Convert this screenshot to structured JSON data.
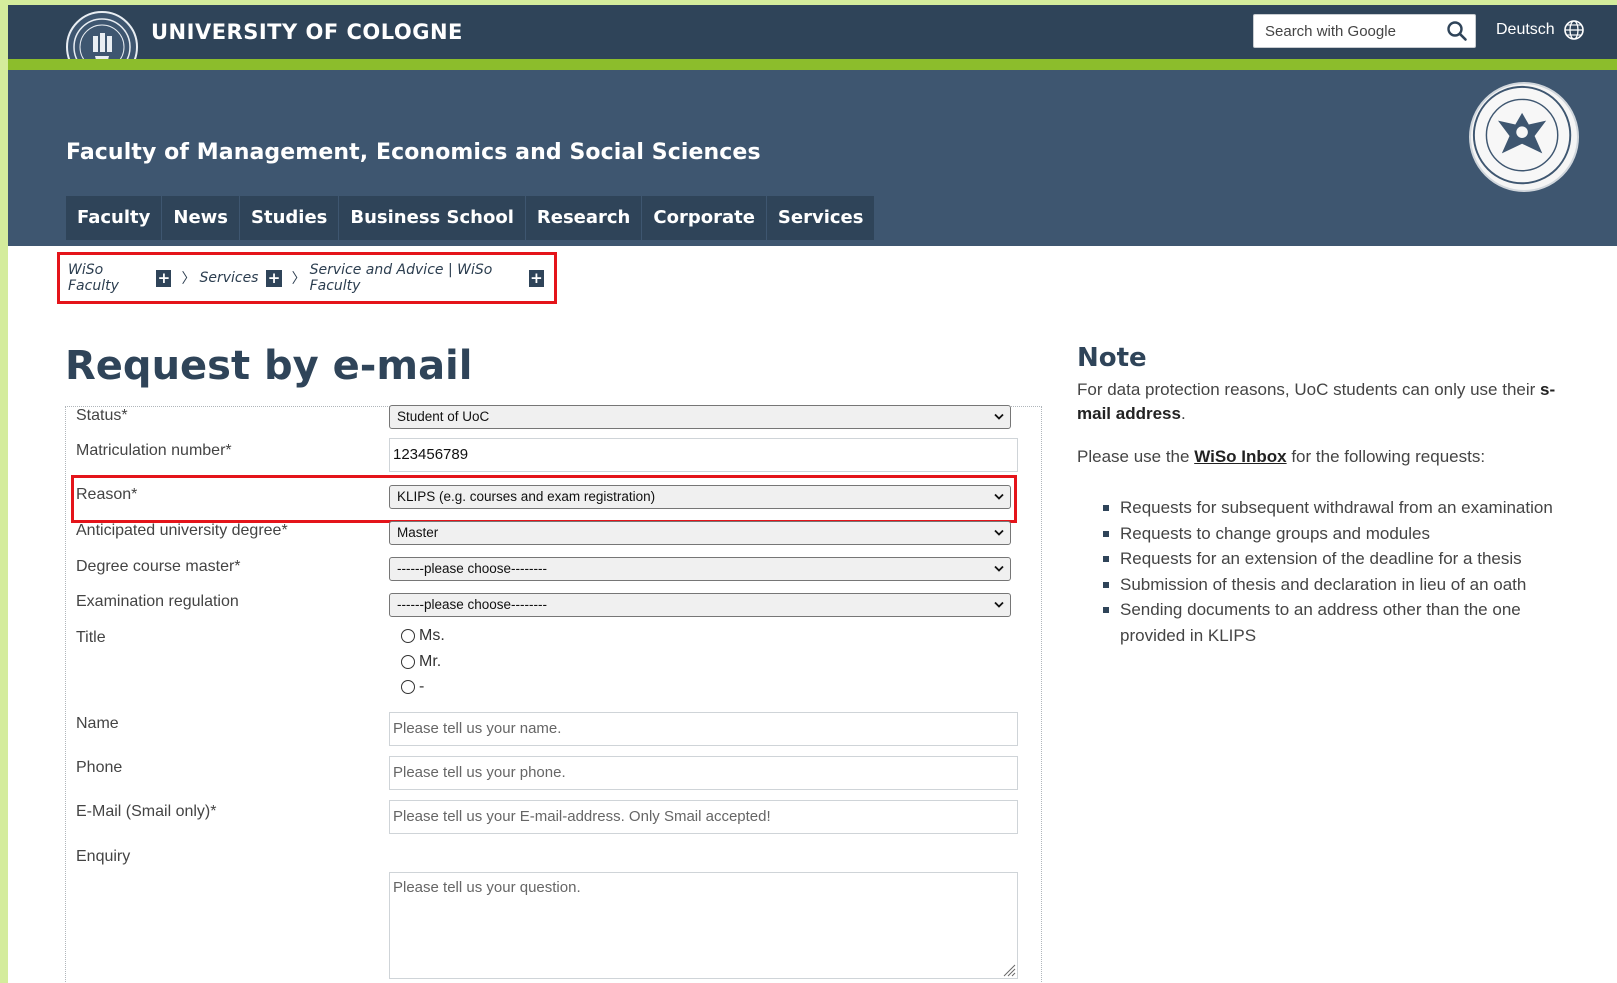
{
  "header": {
    "university_name": "UNIVERSITY OF COLOGNE",
    "search_placeholder": "Search with Google",
    "language_link": "Deutsch",
    "faculty_title": "Faculty of Management, Economics and Social Sciences"
  },
  "nav": {
    "items": [
      {
        "label": "Faculty"
      },
      {
        "label": "News"
      },
      {
        "label": "Studies"
      },
      {
        "label": "Business School"
      },
      {
        "label": "Research"
      },
      {
        "label": "Corporate"
      },
      {
        "label": "Services"
      }
    ]
  },
  "breadcrumb": {
    "items": [
      {
        "label": "WiSo Faculty"
      },
      {
        "label": "Services"
      },
      {
        "label": "Service and Advice | WiSo Faculty"
      }
    ],
    "separator": "〉",
    "expand_symbol": "+"
  },
  "form": {
    "title": "Request by e-mail",
    "status_label": "Status*",
    "status_value": "Student of UoC",
    "matric_label": "Matriculation number*",
    "matric_value": "123456789",
    "reason_label": "Reason*",
    "reason_value": "KLIPS (e.g. courses and exam registration)",
    "degree_label": "Anticipated university degree*",
    "degree_value": "Master",
    "course_label": "Degree course master*",
    "course_value": "------please choose--------",
    "regulation_label": "Examination regulation",
    "regulation_value": "------please choose--------",
    "title_label": "Title",
    "title_options": [
      "Ms.",
      "Mr.",
      "-"
    ],
    "name_label": "Name",
    "name_placeholder": "Please tell us your name.",
    "phone_label": "Phone",
    "phone_placeholder": "Please tell us your phone.",
    "email_label": "E-Mail (Smail only)*",
    "email_placeholder": "Please tell us your E-mail-address. Only Smail accepted!",
    "enquiry_label": "Enquiry",
    "enquiry_placeholder": "Please tell us your question."
  },
  "note": {
    "title": "Note",
    "p1_text": "For data protection reasons, UoC students can only use their ",
    "p1_bold": "s-mail address",
    "p1_end": ".",
    "p2_start": "Please use the ",
    "p2_link": "WiSo Inbox",
    "p2_end": " for the following requests:",
    "list": [
      "Requests for subsequent withdrawal from an examination",
      "Requests to change groups and modules",
      "Requests for an extension of the deadline for a thesis",
      "Submission of thesis and declaration in lieu of an oath",
      "Sending documents to an address other than the one provided in KLIPS"
    ]
  },
  "colors": {
    "header_dark": "#2f4459",
    "header_mid": "#3e5670",
    "accent_green": "#8cbd2c",
    "highlight_red": "#e4141a"
  }
}
